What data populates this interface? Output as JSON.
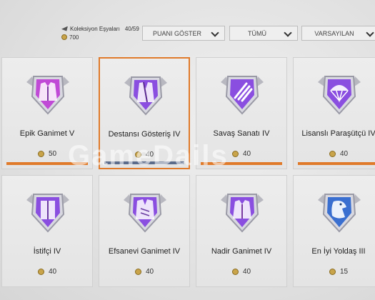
{
  "header": {
    "collection_label": "Koleksiyon Eşyaları",
    "collection_count": "40/59",
    "points_total": "700"
  },
  "filters": {
    "points": "PUANI GÖSTER",
    "all": "TÜMÜ",
    "sort": "VARSAYILAN"
  },
  "watermark": "GameDails",
  "items": [
    {
      "name": "Epik Ganimet V",
      "points": "50",
      "icon": "jacket-icon",
      "color": "#c04ad6",
      "progress": 1.0
    },
    {
      "name": "Destansı Gösteriş IV",
      "points": "40",
      "icon": "coat-icon",
      "color": "#8a4ee0",
      "progress": 1.0,
      "selected": true
    },
    {
      "name": "Savaş Sanatı IV",
      "points": "40",
      "icon": "claw-icon",
      "color": "#8a4ee0",
      "progress": 1.0
    },
    {
      "name": "Lisanslı Paraşütçü IV",
      "points": "40",
      "icon": "parachute-icon",
      "color": "#8a4ee0",
      "progress": 1.0
    },
    {
      "name": "İstifçi IV",
      "points": "40",
      "icon": "locker-icon",
      "color": "#8a4ee0"
    },
    {
      "name": "Efsanevi Ganimet IV",
      "points": "40",
      "icon": "suit-icon",
      "color": "#8a4ee0"
    },
    {
      "name": "Nadir Ganimet IV",
      "points": "40",
      "icon": "jacket-icon",
      "color": "#8a4ee0"
    },
    {
      "name": "En İyi Yoldaş III",
      "points": "15",
      "icon": "eagle-icon",
      "color": "#3a6fd0"
    }
  ]
}
